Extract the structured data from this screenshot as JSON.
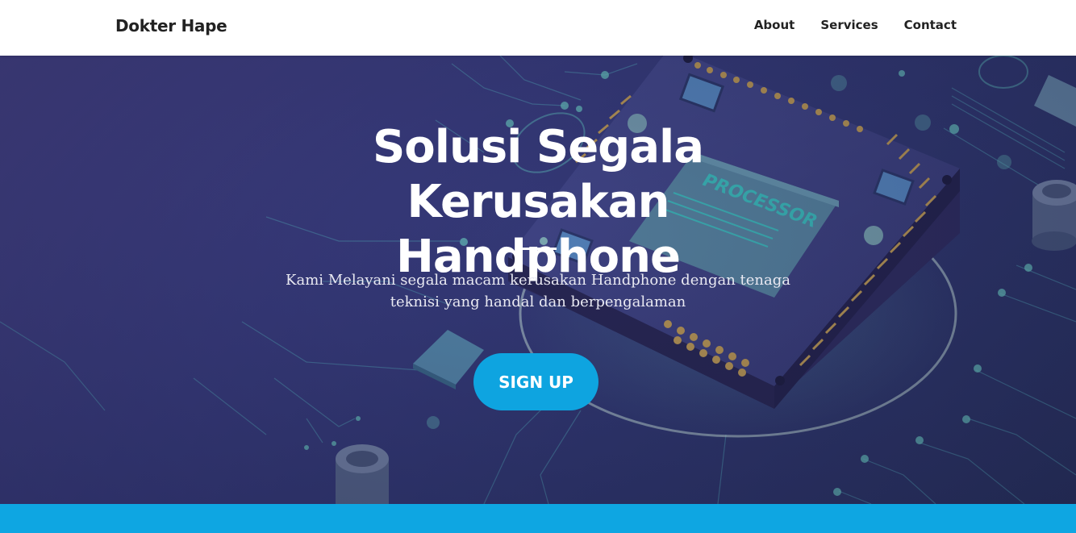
{
  "navbar": {
    "brand": "Dokter Hape",
    "links": [
      {
        "label": "About"
      },
      {
        "label": "Services"
      },
      {
        "label": "Contact"
      }
    ]
  },
  "hero": {
    "title": "Solusi Segala Kerusakan Handphone",
    "subtitle": "Kami Melayani segala macam kerusakan Handphone dengan tenaga teknisi yang handal dan berpengalaman",
    "cta_label": "SIGN UP",
    "chip_label": "PROCESSOR"
  },
  "colors": {
    "accent": "#0ea4e0",
    "hero_bg": "#3c3f84",
    "navbar_bg": "#ffffff"
  }
}
